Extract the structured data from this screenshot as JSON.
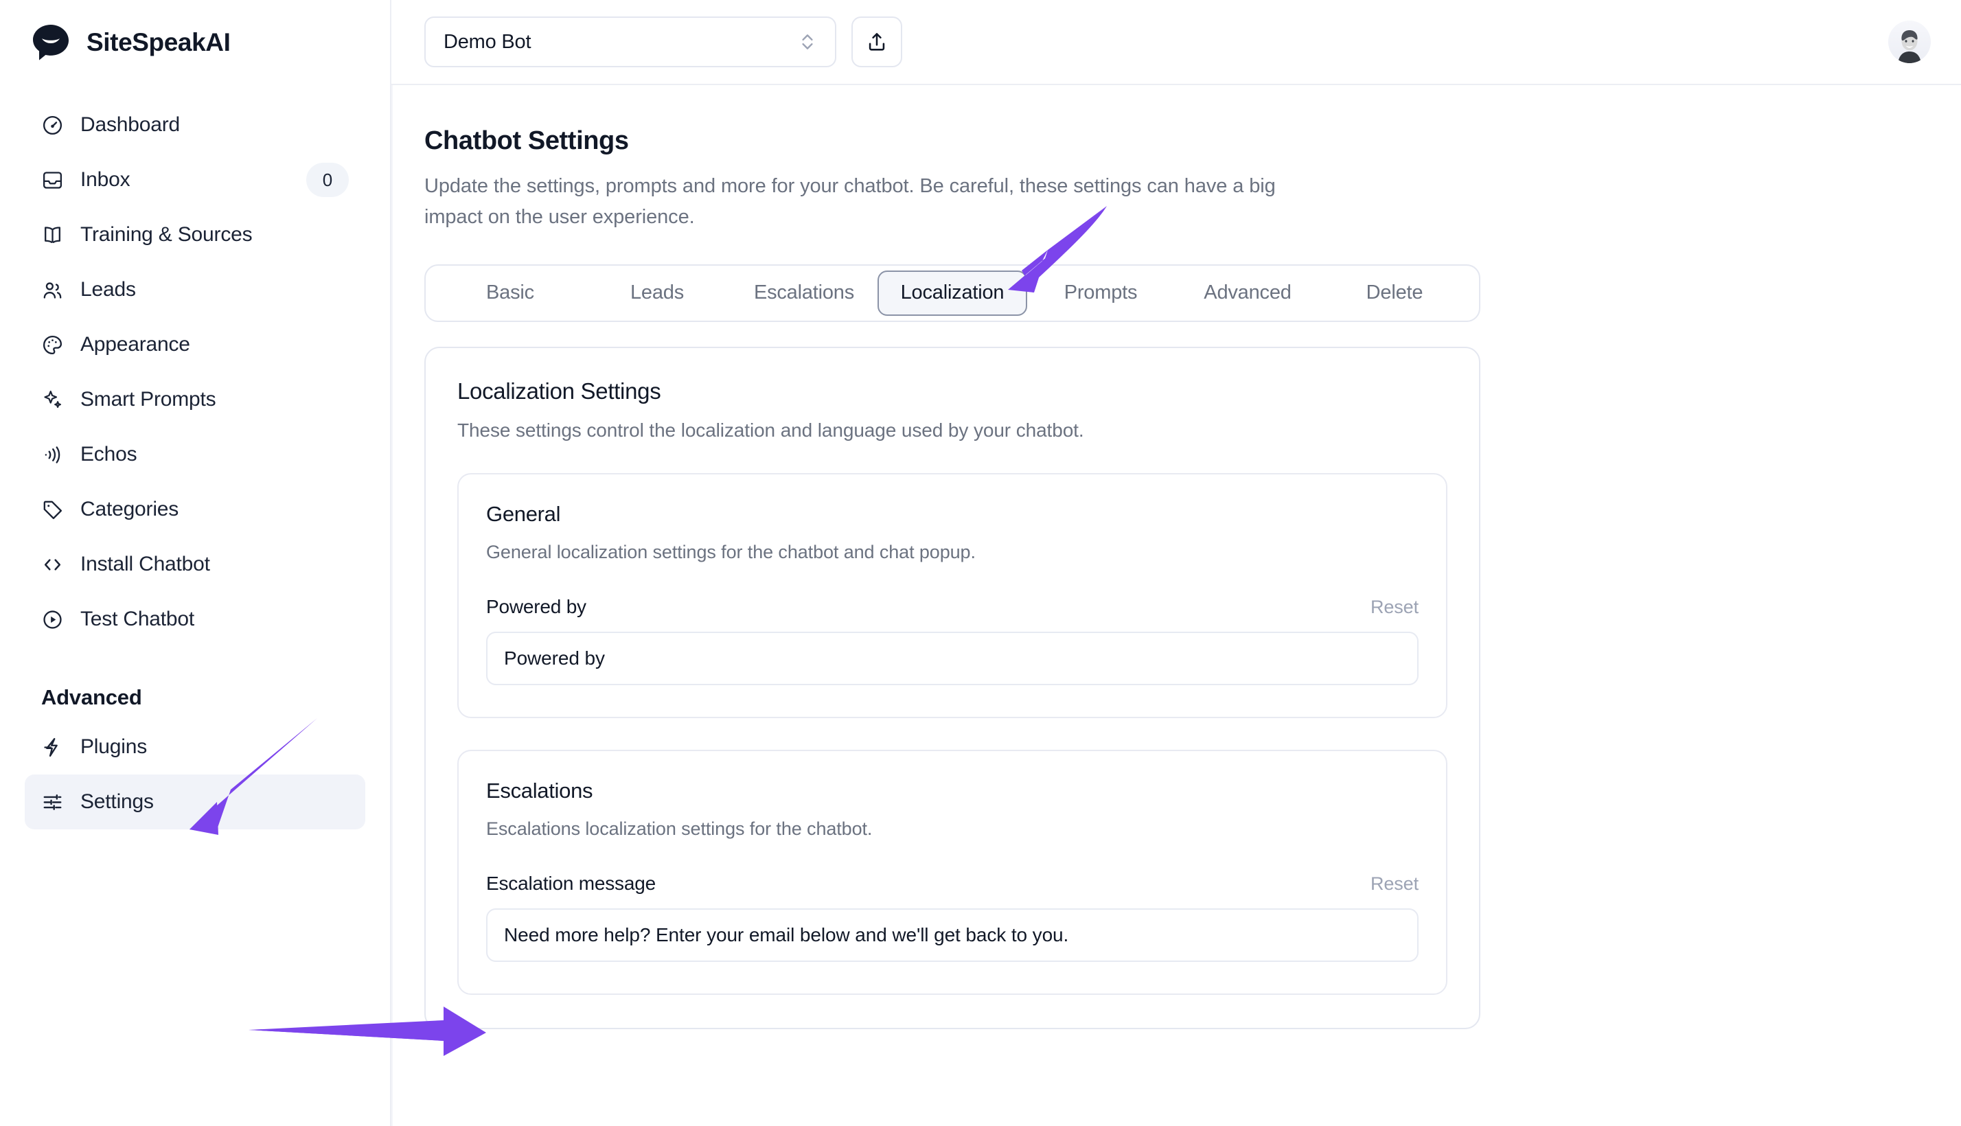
{
  "brand": {
    "name": "SiteSpeakAI",
    "logo_icon": "chat-bubble-logo"
  },
  "sidebar": {
    "items": [
      {
        "label": "Dashboard",
        "icon": "gauge-icon",
        "badge": null,
        "active": false
      },
      {
        "label": "Inbox",
        "icon": "inbox-icon",
        "badge": "0",
        "active": false
      },
      {
        "label": "Training & Sources",
        "icon": "book-open-icon",
        "badge": null,
        "active": false
      },
      {
        "label": "Leads",
        "icon": "users-icon",
        "badge": null,
        "active": false
      },
      {
        "label": "Appearance",
        "icon": "palette-icon",
        "badge": null,
        "active": false
      },
      {
        "label": "Smart Prompts",
        "icon": "sparkles-icon",
        "badge": null,
        "active": false
      },
      {
        "label": "Echos",
        "icon": "audio-waves-icon",
        "badge": null,
        "active": false
      },
      {
        "label": "Categories",
        "icon": "tag-icon",
        "badge": null,
        "active": false
      },
      {
        "label": "Install Chatbot",
        "icon": "code-brackets-icon",
        "badge": null,
        "active": false
      },
      {
        "label": "Test Chatbot",
        "icon": "play-circle-icon",
        "badge": null,
        "active": false
      }
    ],
    "advanced_section_title": "Advanced",
    "advanced_items": [
      {
        "label": "Plugins",
        "icon": "lightning-bolt-icon",
        "badge": null,
        "active": false
      },
      {
        "label": "Settings",
        "icon": "sliders-icon",
        "badge": null,
        "active": true
      }
    ]
  },
  "topbar": {
    "bot_selector_value": "Demo Bot",
    "bot_selector_icon": "chevron-up-down-icon",
    "share_button_icon": "share-upload-icon",
    "avatar_icon": "user-avatar"
  },
  "page": {
    "title": "Chatbot Settings",
    "subtitle": "Update the settings, prompts and more for your chatbot. Be careful, these settings can have a big impact on the user experience."
  },
  "tabs": [
    {
      "label": "Basic",
      "active": false
    },
    {
      "label": "Leads",
      "active": false
    },
    {
      "label": "Escalations",
      "active": false
    },
    {
      "label": "Localization",
      "active": true
    },
    {
      "label": "Prompts",
      "active": false
    },
    {
      "label": "Advanced",
      "active": false
    },
    {
      "label": "Delete",
      "active": false
    }
  ],
  "localization_card": {
    "title": "Localization Settings",
    "description": "These settings control the localization and language used by your chatbot.",
    "sections": [
      {
        "title": "General",
        "description": "General localization settings for the chatbot and chat popup.",
        "fields": [
          {
            "label": "Powered by",
            "reset_label": "Reset",
            "value": "Powered by",
            "placeholder": "Powered by"
          }
        ]
      },
      {
        "title": "Escalations",
        "description": "Escalations localization settings for the chatbot.",
        "fields": [
          {
            "label": "Escalation message",
            "reset_label": "Reset",
            "value": "Need more help? Enter your email below and we'll get back to you.",
            "placeholder": "Escalation message"
          }
        ]
      }
    ]
  },
  "annotations": {
    "accent_color": "#7c44ec",
    "arrows": [
      {
        "name": "arrow-to-localization-tab",
        "points_to": "Localization tab"
      },
      {
        "name": "arrow-to-settings-nav",
        "points_to": "Settings sidebar item"
      },
      {
        "name": "arrow-to-escalation-message-input",
        "points_to": "Escalation message input"
      }
    ]
  },
  "colors": {
    "accent": "#7c44ec",
    "text_primary": "#111827",
    "text_muted": "#6b7280",
    "border": "#e4e7f0",
    "active_nav_bg": "#f1f3f9"
  }
}
